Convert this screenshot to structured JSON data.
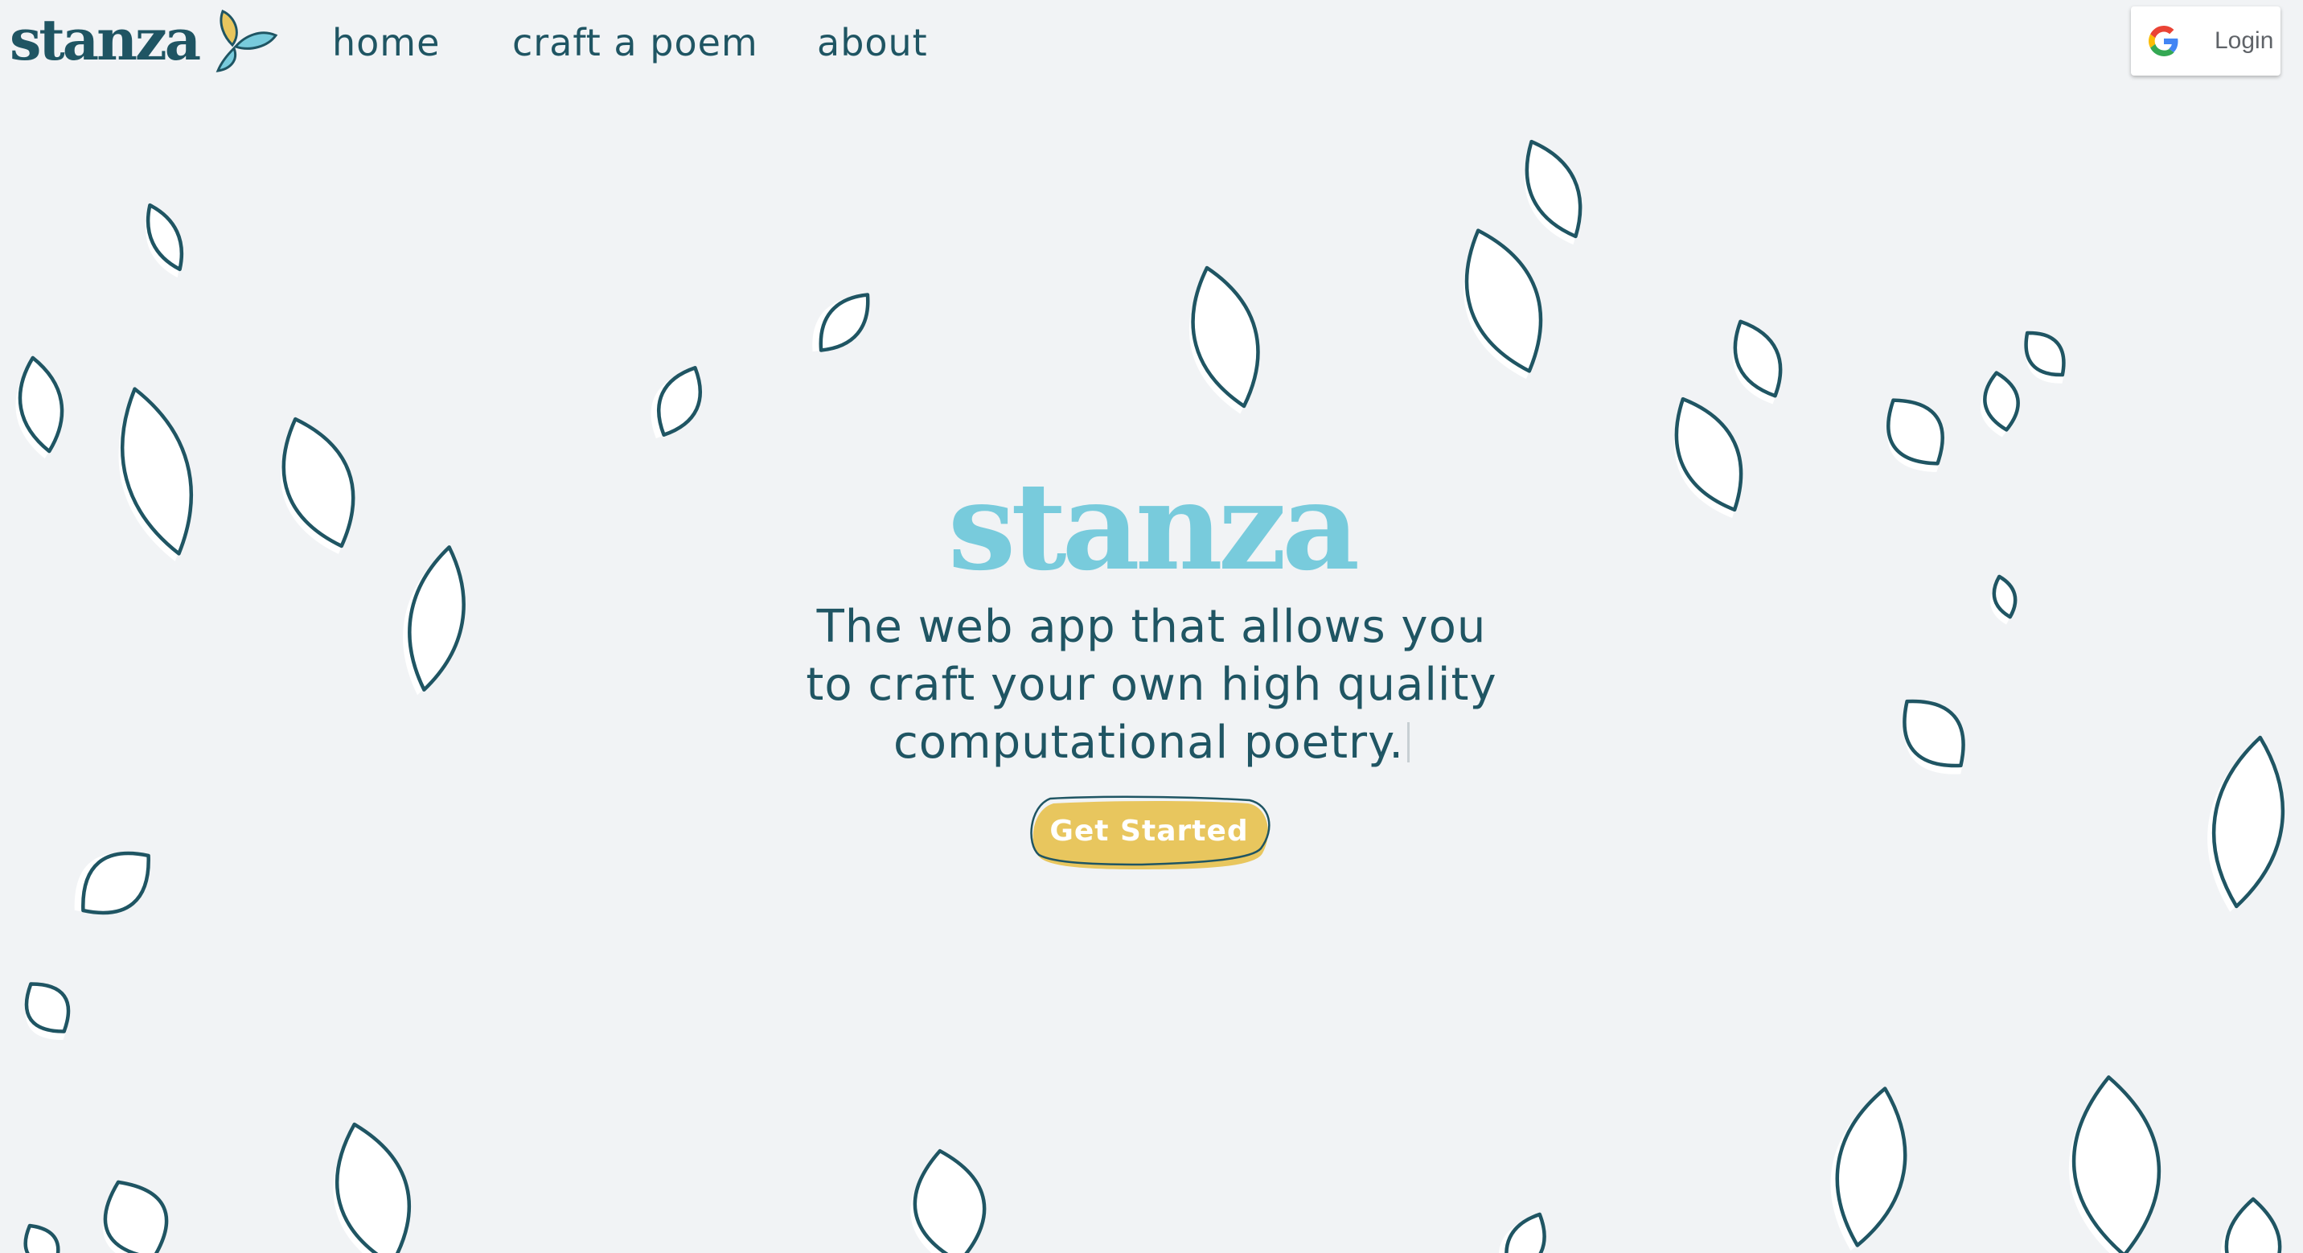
{
  "brand": {
    "logo_text": "stanza",
    "sprout_icon": "leaf-sprout-icon"
  },
  "nav": {
    "items": [
      {
        "label": "home"
      },
      {
        "label": "craft a poem"
      },
      {
        "label": "about"
      }
    ]
  },
  "auth": {
    "login_label": "Login",
    "provider_icon": "google-icon"
  },
  "hero": {
    "title": "stanza",
    "tagline": "The web app that allows you to craft your own high quality computational poetry.",
    "cta_label": "Get Started"
  },
  "colors": {
    "background": "#f1f3f5",
    "primary_dark": "#1f5563",
    "accent_blue": "#78cbdc",
    "accent_gold": "#e8c65e"
  }
}
